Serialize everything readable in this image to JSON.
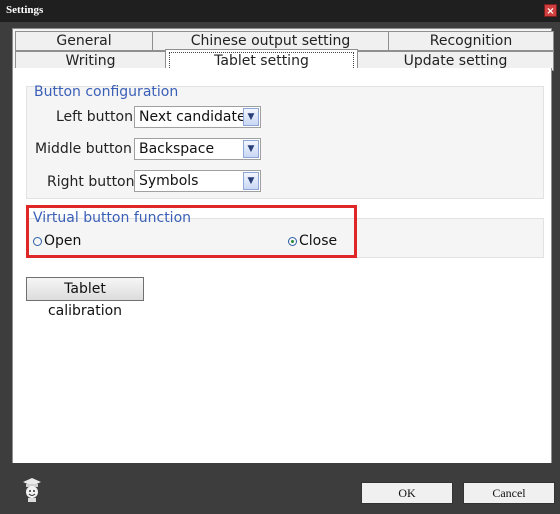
{
  "window": {
    "title": "Settings",
    "close_label": "×"
  },
  "tabs_row1": [
    {
      "label": "General"
    },
    {
      "label": "Chinese output setting"
    },
    {
      "label": "Recognition"
    }
  ],
  "tabs_row2": [
    {
      "label": "Writing"
    },
    {
      "label": "Tablet setting",
      "active": true
    },
    {
      "label": "Update setting"
    }
  ],
  "button_config": {
    "title": "Button configuration",
    "left": {
      "label": "Left button",
      "value": "Next candidate"
    },
    "middle": {
      "label": "Middle button",
      "value": "Backspace"
    },
    "right": {
      "label": "Right button",
      "value": "Symbols"
    }
  },
  "virtual": {
    "title": "Virtual button function",
    "open_label": "Open",
    "close_label": "Close",
    "selected": "Close"
  },
  "calibration_label": "Tablet calibration",
  "footer": {
    "ok_label": "OK",
    "cancel_label": "Cancel"
  },
  "colors": {
    "accent": "#3a5fb7",
    "highlight": "#e02727"
  }
}
